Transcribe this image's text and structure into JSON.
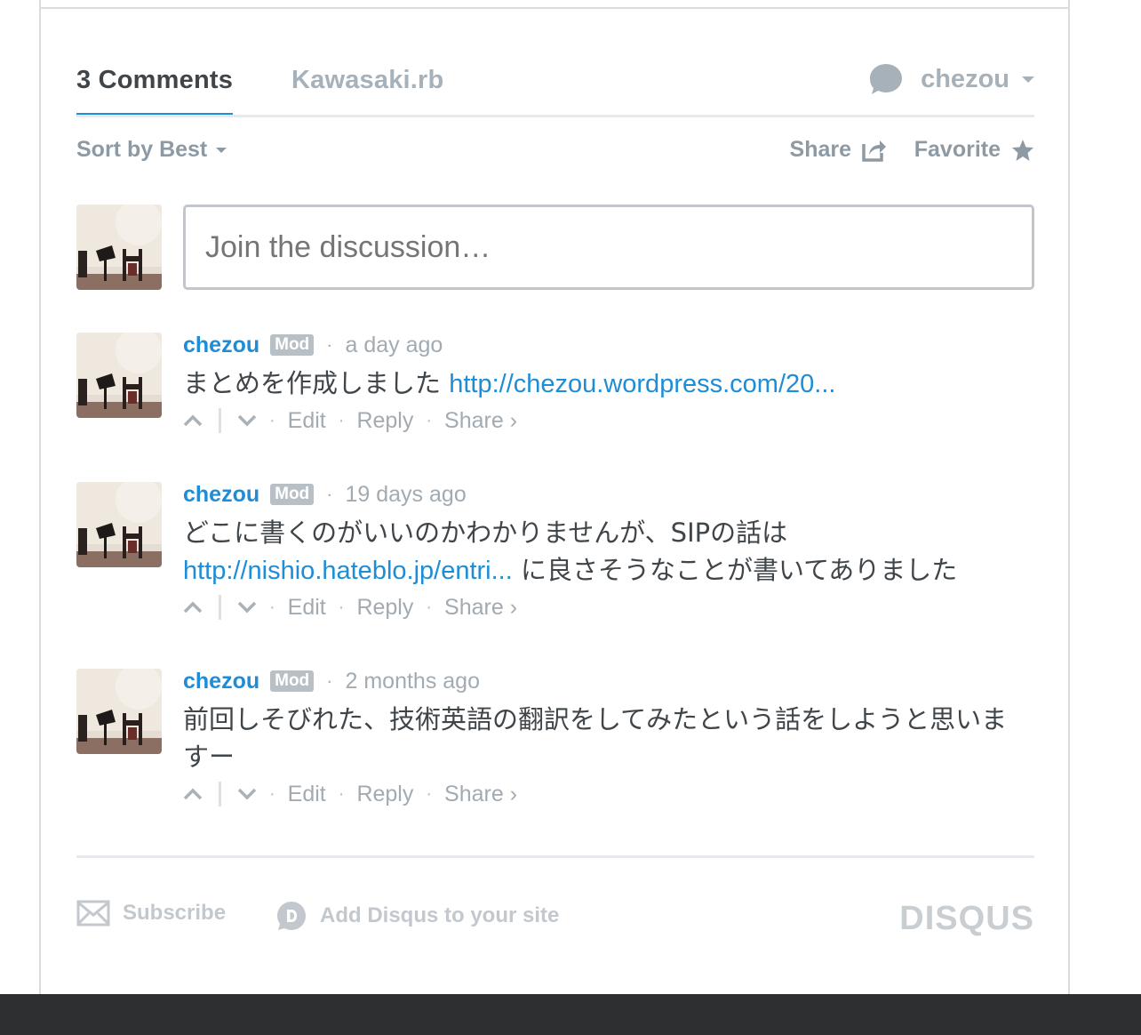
{
  "nav": {
    "comments_tab": "3 Comments",
    "forum_tab": "Kawasaki.rb",
    "user_name": "chezou"
  },
  "toolbar": {
    "sort_label": "Sort by Best",
    "share_label": "Share",
    "favorite_label": "Favorite"
  },
  "composer": {
    "placeholder": "Join the discussion…"
  },
  "comments": [
    {
      "author": "chezou",
      "badge": "Mod",
      "time": "a day ago",
      "text_before": "まとめを作成しました ",
      "link": "http://chezou.wordpress.com/20...",
      "text_after": ""
    },
    {
      "author": "chezou",
      "badge": "Mod",
      "time": "19 days ago",
      "text_before": "どこに書くのがいいのかわかりませんが、SIPの話は",
      "link": "http://nishio.hateblo.jp/entri...",
      "text_after": " に良さそうなことが書いてありました"
    },
    {
      "author": "chezou",
      "badge": "Mod",
      "time": "2 months ago",
      "text_before": "前回しそびれた、技術英語の翻訳をしてみたという話をしようと思いますー",
      "link": "",
      "text_after": ""
    }
  ],
  "actions": {
    "edit": "Edit",
    "reply": "Reply",
    "share": "Share ›"
  },
  "footer": {
    "subscribe": "Subscribe",
    "add_disqus": "Add Disqus to your site",
    "brand": "DISQUS"
  },
  "colors": {
    "accent": "#1f8dd6",
    "muted": "#a2abb2",
    "text": "#3f4549",
    "bottom_bar": "#2e2f30"
  },
  "icons": [
    "comment-bubble-icon",
    "caret-down-icon",
    "share-box-icon",
    "star-icon",
    "upvote-icon",
    "downvote-icon",
    "envelope-icon",
    "disqus-logo-icon"
  ]
}
